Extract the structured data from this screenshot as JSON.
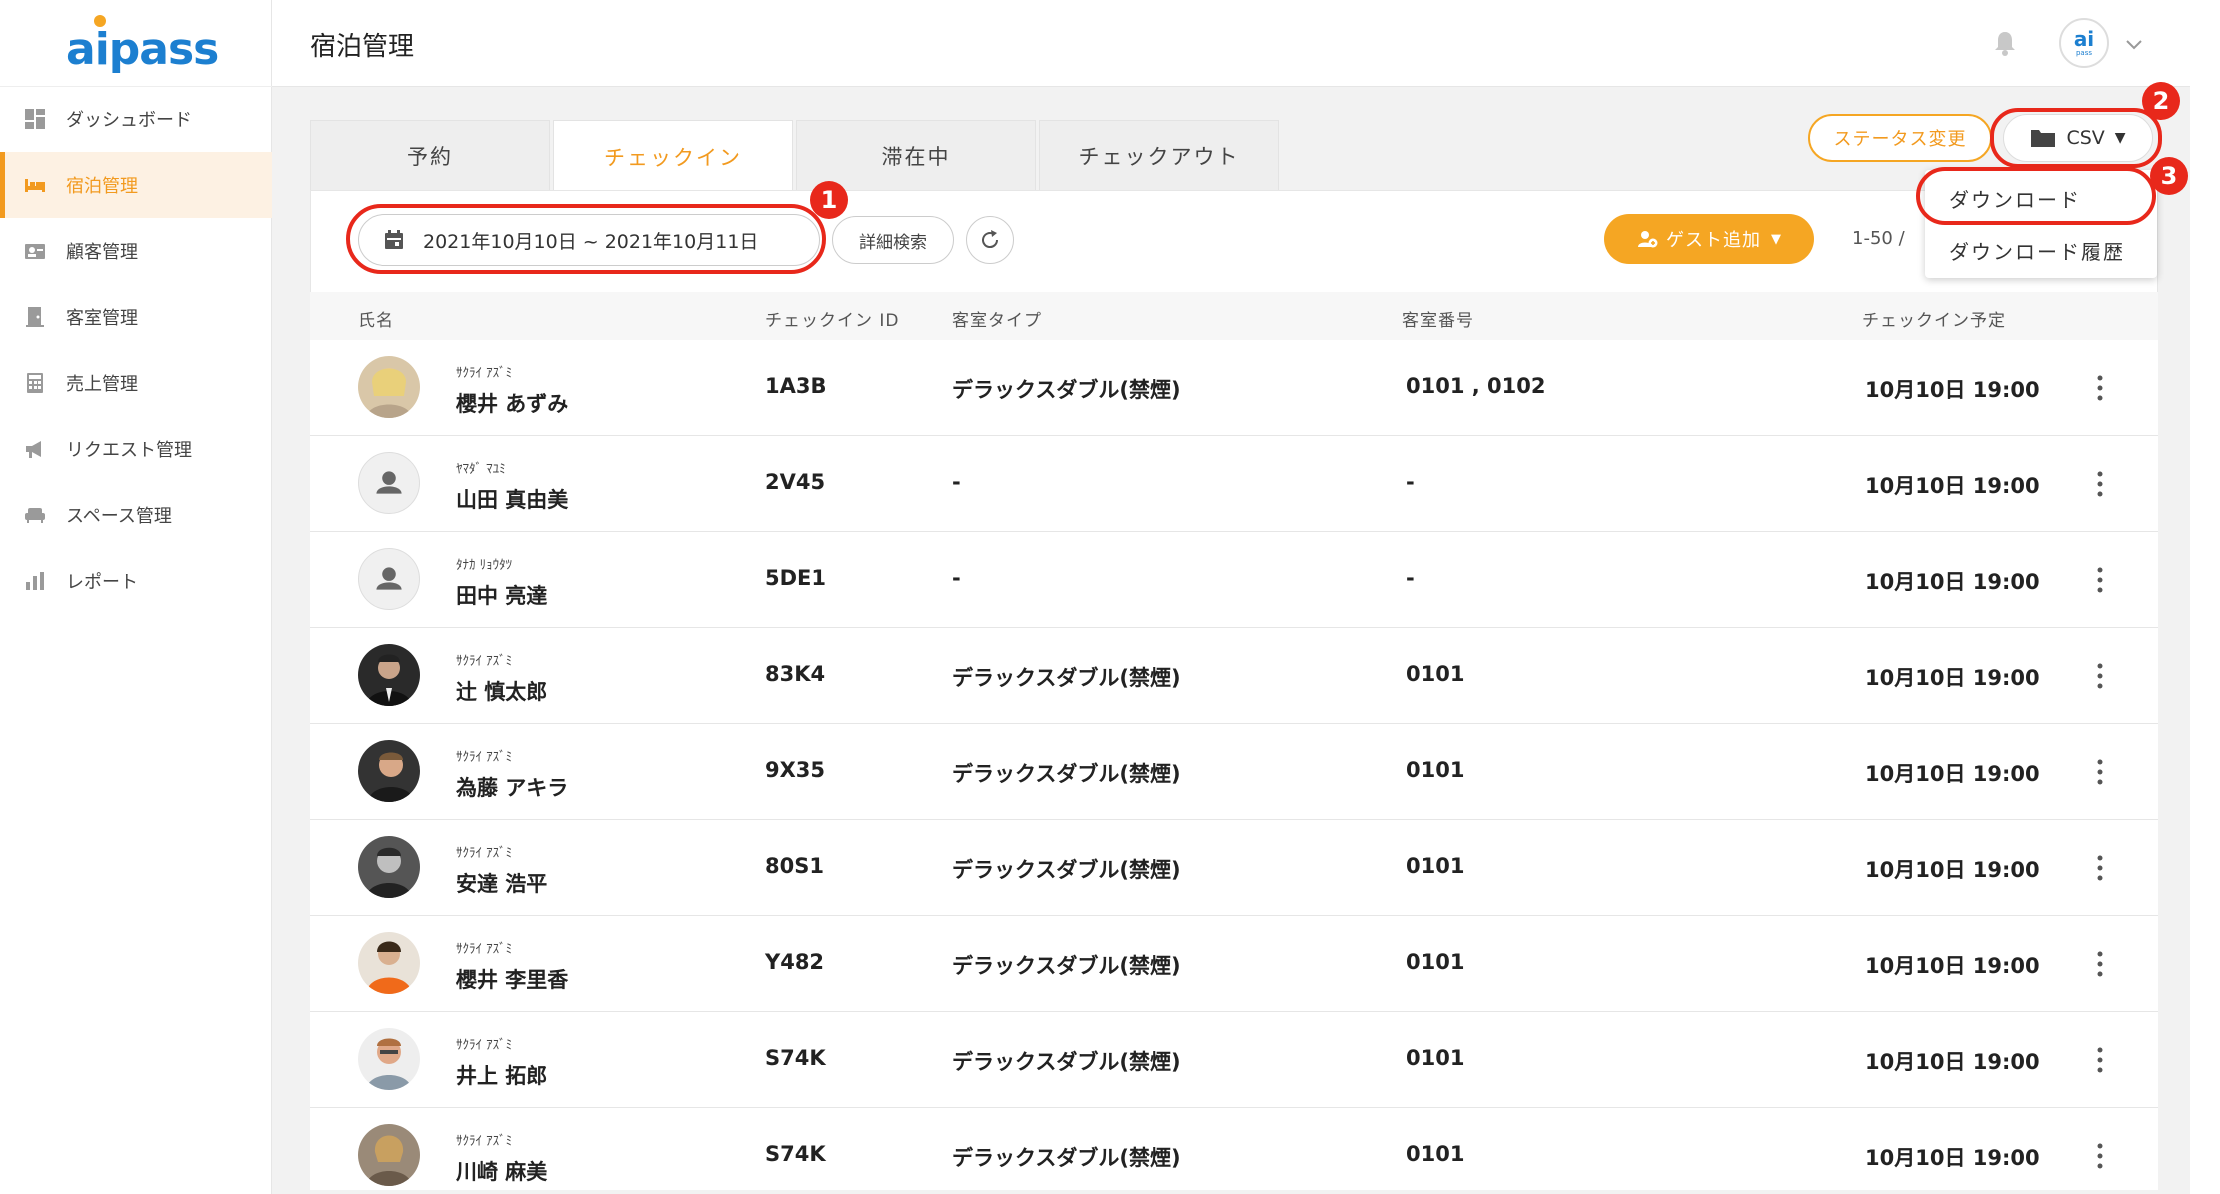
{
  "app": {
    "logo_text": "aipass"
  },
  "sidebar": {
    "items": [
      {
        "label": "ダッシュボード",
        "icon": "dashboard-icon"
      },
      {
        "label": "宿泊管理",
        "icon": "bed-icon",
        "active": true
      },
      {
        "label": "顧客管理",
        "icon": "contact-card-icon"
      },
      {
        "label": "客室管理",
        "icon": "door-icon"
      },
      {
        "label": "売上管理",
        "icon": "calculator-icon"
      },
      {
        "label": "リクエスト管理",
        "icon": "megaphone-icon"
      },
      {
        "label": "スペース管理",
        "icon": "sofa-icon"
      },
      {
        "label": "レポート",
        "icon": "bar-chart-icon"
      }
    ]
  },
  "header": {
    "title": "宿泊管理",
    "avatar_text": "ai",
    "avatar_subtext": "pass"
  },
  "tabs": [
    {
      "label": "予約"
    },
    {
      "label": "チェックイン",
      "active": true
    },
    {
      "label": "滞在中"
    },
    {
      "label": "チェックアウト"
    }
  ],
  "toolbar": {
    "status_change_label": "ステータス変更",
    "csv_label": "CSV",
    "csv_menu": [
      {
        "label": "ダウンロード"
      },
      {
        "label": "ダウンロード履歴"
      }
    ],
    "date_range": "2021年10月10日 ~ 2021年10月11日",
    "detail_search_label": "詳細検索",
    "add_guest_label": "ゲスト追加",
    "paging": "1-50 /"
  },
  "annotations": {
    "one": "1",
    "two": "2",
    "three": "3"
  },
  "table": {
    "headers": {
      "name": "氏名",
      "checkin_id": "チェックイン ID",
      "room_type": "客室タイプ",
      "room_number": "客室番号",
      "checkin_scheduled": "チェックイン予定"
    },
    "rows": [
      {
        "kana": "ｻｸﾗｲ ｱｽﾞﾐ",
        "name": "櫻井 あずみ",
        "id": "1A3B",
        "room_type": "デラックスダブル(禁煙)",
        "room_number": "0101 , 0102",
        "time": "10月10日 19:00",
        "avatar": "photo"
      },
      {
        "kana": "ﾔﾏﾀﾞ ﾏﾕﾐ",
        "name": "山田 真由美",
        "id": "2V45",
        "room_type": "-",
        "room_number": "-",
        "time": "10月10日 19:00",
        "avatar": "placeholder"
      },
      {
        "kana": "ﾀﾅｶ ﾘｮｳﾀﾂ",
        "name": "田中 亮達",
        "id": "5DE1",
        "room_type": "-",
        "room_number": "-",
        "time": "10月10日 19:00",
        "avatar": "placeholder"
      },
      {
        "kana": "ｻｸﾗｲ ｱｽﾞﾐ",
        "name": "辻 慎太郎",
        "id": "83K4",
        "room_type": "デラックスダブル(禁煙)",
        "room_number": "0101",
        "time": "10月10日 19:00",
        "avatar": "photo"
      },
      {
        "kana": "ｻｸﾗｲ ｱｽﾞﾐ",
        "name": "為藤 アキラ",
        "id": "9X35",
        "room_type": "デラックスダブル(禁煙)",
        "room_number": "0101",
        "time": "10月10日 19:00",
        "avatar": "photo"
      },
      {
        "kana": "ｻｸﾗｲ ｱｽﾞﾐ",
        "name": "安達 浩平",
        "id": "80S1",
        "room_type": "デラックスダブル(禁煙)",
        "room_number": "0101",
        "time": "10月10日 19:00",
        "avatar": "photo"
      },
      {
        "kana": "ｻｸﾗｲ ｱｽﾞﾐ",
        "name": "櫻井 李里香",
        "id": "Y482",
        "room_type": "デラックスダブル(禁煙)",
        "room_number": "0101",
        "time": "10月10日 19:00",
        "avatar": "photo"
      },
      {
        "kana": "ｻｸﾗｲ ｱｽﾞﾐ",
        "name": "井上 拓郎",
        "id": "S74K",
        "room_type": "デラックスダブル(禁煙)",
        "room_number": "0101",
        "time": "10月10日 19:00",
        "avatar": "photo"
      },
      {
        "kana": "ｻｸﾗｲ ｱｽﾞﾐ",
        "name": "川崎 麻美",
        "id": "S74K",
        "room_type": "デラックスダブル(禁煙)",
        "room_number": "0101",
        "time": "10月10日 19:00",
        "avatar": "photo"
      }
    ]
  },
  "colors": {
    "accent": "#f29a1f",
    "brand_blue": "#1c7fd0",
    "annotation_red": "#e8281b"
  }
}
